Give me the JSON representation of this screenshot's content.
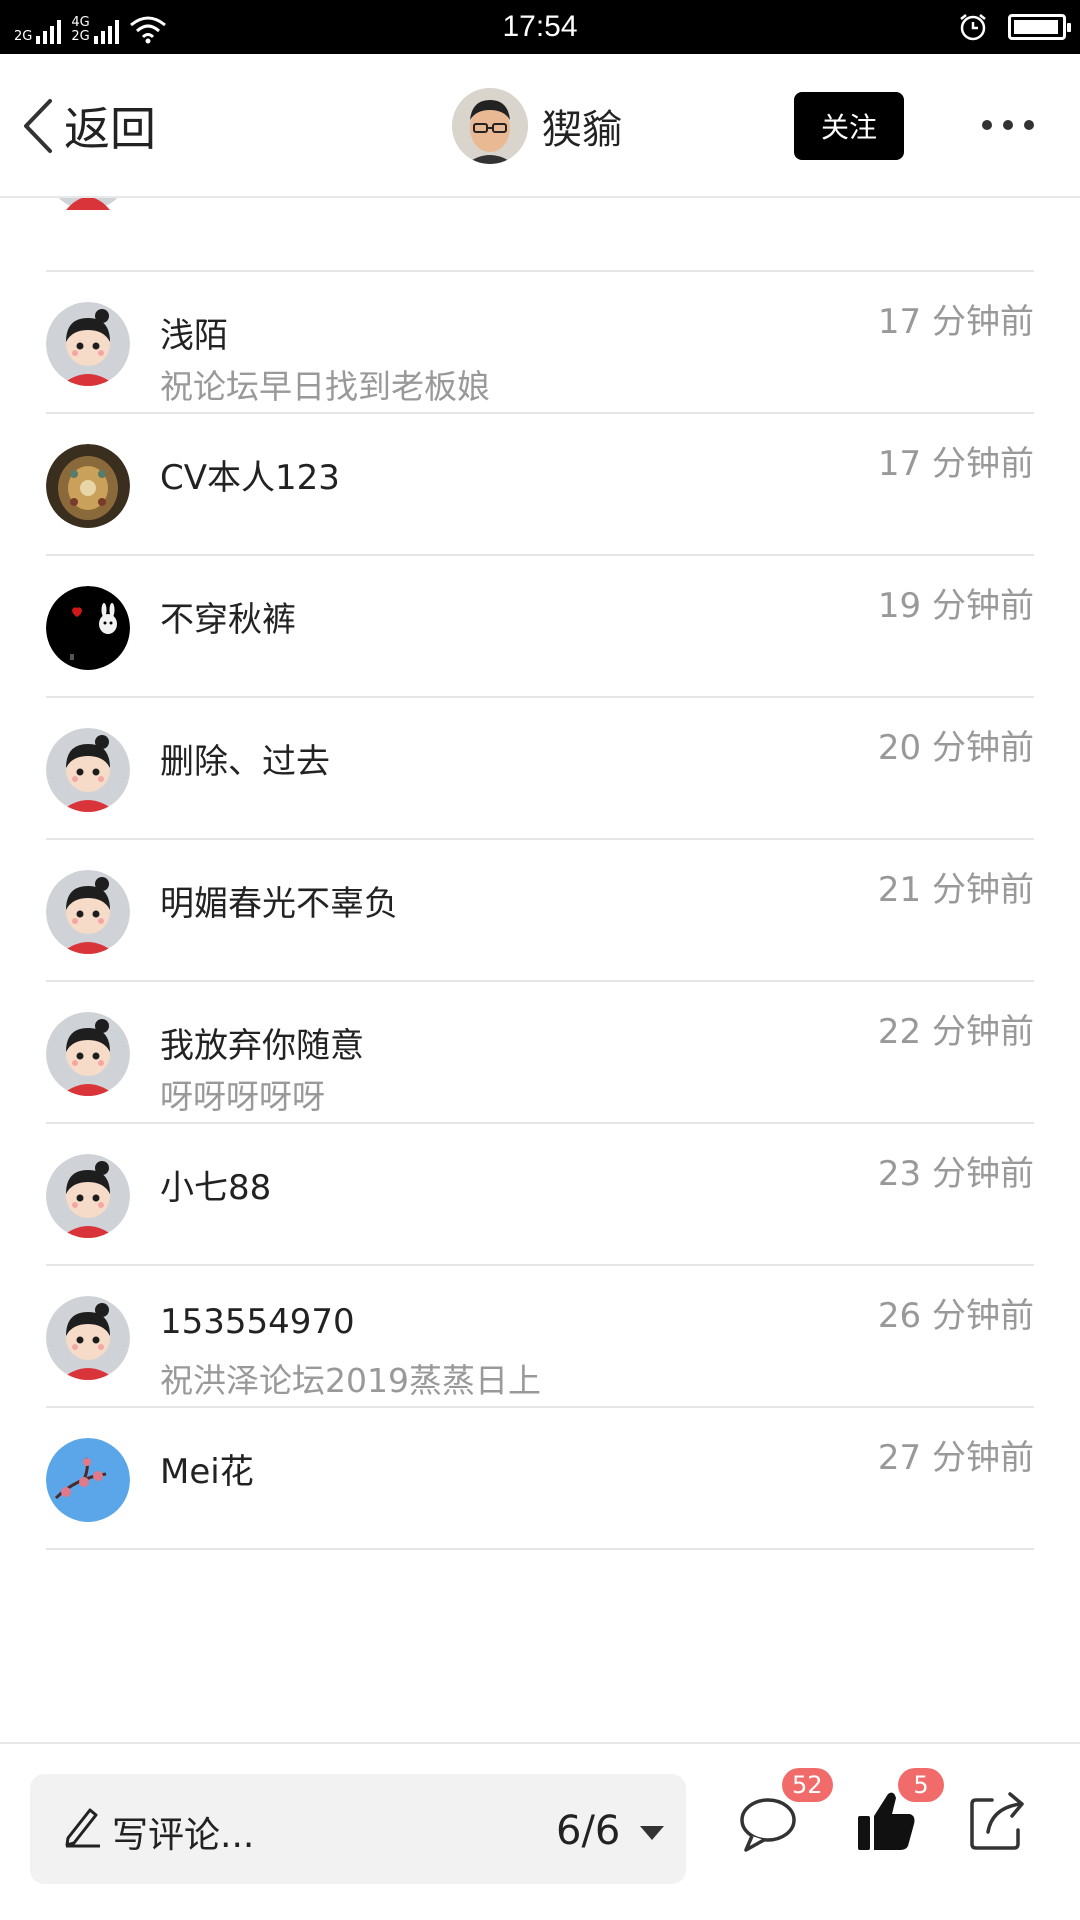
{
  "status_bar": {
    "net1": "2G",
    "net2_top": "4G",
    "net2_bottom": "2G",
    "time": "17:54",
    "icons": [
      "signal-icon",
      "wifi-icon",
      "alarm-icon",
      "battery-icon"
    ],
    "battery_level": 0.95
  },
  "nav": {
    "back_label": "返回",
    "author_name": "猰貐",
    "follow_label": "关注",
    "more_icon": "more-dots-icon"
  },
  "comments": [
    {
      "username": "浅陌",
      "text": "祝论坛早日找到老板娘",
      "time": "17 分钟前",
      "avatar": "cartoon-girl"
    },
    {
      "username": "CV本人123",
      "text": "",
      "time": "17 分钟前",
      "avatar": "ornament"
    },
    {
      "username": "不穿秋裤",
      "text": "",
      "time": "19 分钟前",
      "avatar": "dark-bunny"
    },
    {
      "username": "删除、过去",
      "text": "",
      "time": "20 分钟前",
      "avatar": "cartoon-girl"
    },
    {
      "username": "明媚春光不辜负",
      "text": "",
      "time": "21 分钟前",
      "avatar": "cartoon-girl"
    },
    {
      "username": "我放弃你随意",
      "text": "呀呀呀呀呀",
      "time": "22 分钟前",
      "avatar": "cartoon-girl"
    },
    {
      "username": "小七88",
      "text": "",
      "time": "23 分钟前",
      "avatar": "cartoon-girl"
    },
    {
      "username": "153554970",
      "text": "祝洪泽论坛2019蒸蒸日上",
      "time": "26 分钟前",
      "avatar": "cartoon-girl"
    },
    {
      "username": "Mei花",
      "text": "",
      "time": "27 分钟前",
      "avatar": "plum-blossom"
    }
  ],
  "bottom_bar": {
    "write_placeholder": "写评论...",
    "page_indicator": "6/6",
    "comment_count": "52",
    "like_count": "5",
    "icons": [
      "pencil-icon",
      "caret-down-icon",
      "comment-icon",
      "thumbs-up-icon",
      "share-icon"
    ]
  },
  "colors": {
    "badge": "#f26b6b",
    "follow_bg": "#000000",
    "muted_text": "#999999"
  }
}
